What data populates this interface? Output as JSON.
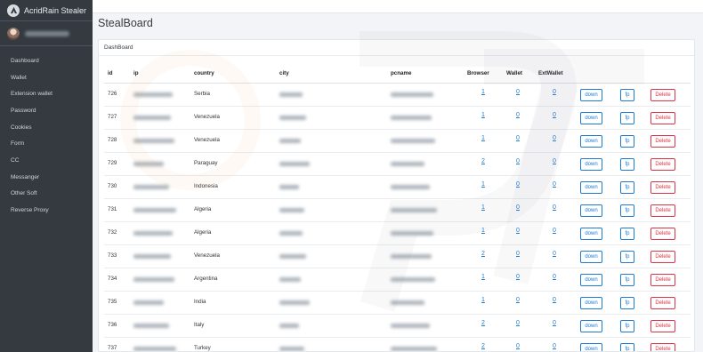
{
  "app": {
    "brand_name": "AcridRain Stealer"
  },
  "sidebar": {
    "items": [
      {
        "label": "Dashboard",
        "name": "sidebar-item-dashboard"
      },
      {
        "label": "Wallet",
        "name": "sidebar-item-wallet"
      },
      {
        "label": "Extension wallet",
        "name": "sidebar-item-extension-wallet"
      },
      {
        "label": "Password",
        "name": "sidebar-item-password"
      },
      {
        "label": "Cookies",
        "name": "sidebar-item-cookies"
      },
      {
        "label": "Form",
        "name": "sidebar-item-form"
      },
      {
        "label": "CC",
        "name": "sidebar-item-cc"
      },
      {
        "label": "Messanger",
        "name": "sidebar-item-messanger"
      },
      {
        "label": "Other Soft",
        "name": "sidebar-item-other-soft"
      },
      {
        "label": "Reverse Proxy",
        "name": "sidebar-item-reverse-proxy"
      }
    ]
  },
  "main": {
    "title": "StealBoard",
    "card_title": "DashBoard"
  },
  "table": {
    "headers": {
      "id": "id",
      "ip": "ip",
      "country": "country",
      "city": "city",
      "pcname": "pcname",
      "browser": "Browser",
      "wallet": "Wallet",
      "extwallet": "ExtWallet"
    },
    "buttons": {
      "down": "down",
      "fp": "fp",
      "delete": "Delete"
    },
    "rows": [
      {
        "id": "726",
        "country": "Serbia",
        "browser": "1",
        "wallet": "0",
        "extwallet": "0"
      },
      {
        "id": "727",
        "country": "Venezuela",
        "browser": "1",
        "wallet": "0",
        "extwallet": "0"
      },
      {
        "id": "728",
        "country": "Venezuela",
        "browser": "1",
        "wallet": "0",
        "extwallet": "0"
      },
      {
        "id": "729",
        "country": "Paraguay",
        "browser": "2",
        "wallet": "0",
        "extwallet": "0"
      },
      {
        "id": "730",
        "country": "Indonesia",
        "browser": "1",
        "wallet": "0",
        "extwallet": "0"
      },
      {
        "id": "731",
        "country": "Algeria",
        "browser": "1",
        "wallet": "0",
        "extwallet": "0"
      },
      {
        "id": "732",
        "country": "Algeria",
        "browser": "1",
        "wallet": "0",
        "extwallet": "0"
      },
      {
        "id": "733",
        "country": "Venezuela",
        "browser": "2",
        "wallet": "0",
        "extwallet": "0"
      },
      {
        "id": "734",
        "country": "Argentina",
        "browser": "1",
        "wallet": "0",
        "extwallet": "0"
      },
      {
        "id": "735",
        "country": "India",
        "browser": "1",
        "wallet": "0",
        "extwallet": "0"
      },
      {
        "id": "736",
        "country": "Italy",
        "browser": "2",
        "wallet": "0",
        "extwallet": "0"
      },
      {
        "id": "737",
        "country": "Turkey",
        "browser": "2",
        "wallet": "0",
        "extwallet": "0"
      }
    ]
  },
  "colors": {
    "sidebar_bg": "#343a40",
    "link": "#1f7ad1",
    "danger": "#dc3545"
  },
  "icons": {
    "brand": "brand-logo-icon"
  }
}
